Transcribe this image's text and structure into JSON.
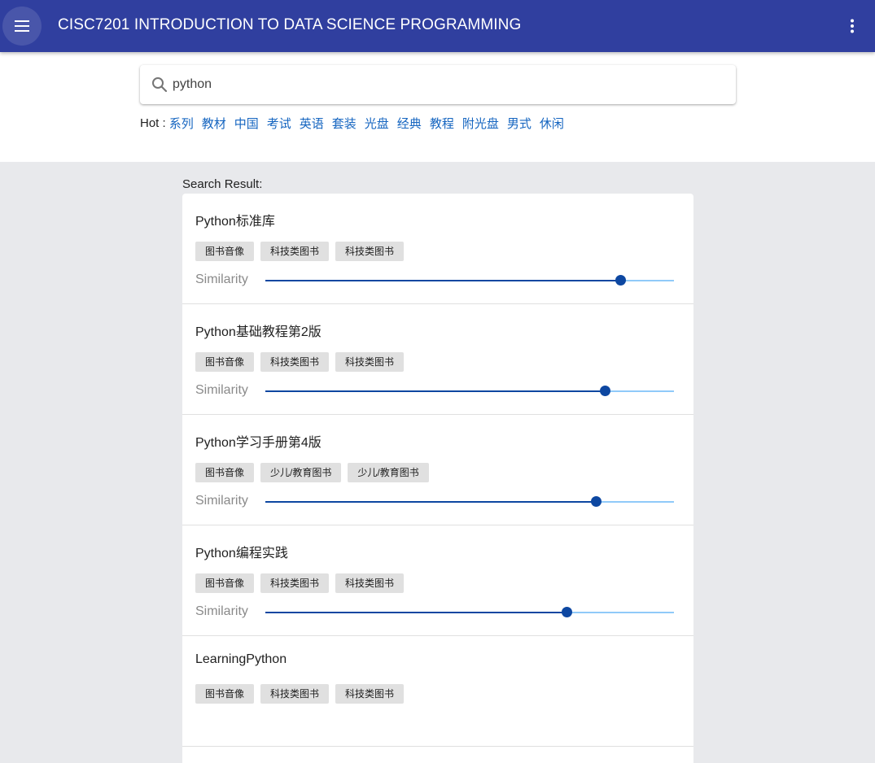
{
  "appbar": {
    "title": "CISC7201 INTRODUCTION TO DATA SCIENCE PROGRAMMING",
    "menu_icon": "hamburger-menu-icon",
    "more_icon": "more-vertical-icon",
    "color": "#303f9f"
  },
  "search": {
    "value": "python",
    "icon": "search-icon"
  },
  "hot": {
    "label": "Hot :",
    "links": [
      "系列",
      "教材",
      "中国",
      "考试",
      "英语",
      "套装",
      "光盘",
      "经典",
      "教程",
      "附光盘",
      "男式",
      "休闲"
    ]
  },
  "results_label": "Search Result:",
  "results": [
    {
      "title": "Python标准库",
      "tags": [
        "图书音像",
        "科技类图书",
        "科技类图书"
      ],
      "similarity_label": "Similarity",
      "similarity": 0.868
    },
    {
      "title": "Python基础教程第2版",
      "tags": [
        "图书音像",
        "科技类图书",
        "科技类图书"
      ],
      "similarity_label": "Similarity",
      "similarity": 0.831
    },
    {
      "title": "Python学习手册第4版",
      "tags": [
        "图书音像",
        "少儿/教育图书",
        "少儿/教育图书"
      ],
      "similarity_label": "Similarity",
      "similarity": 0.809
    },
    {
      "title": "Python编程实践",
      "tags": [
        "图书音像",
        "科技类图书",
        "科技类图书"
      ],
      "similarity_label": "Similarity",
      "similarity": 0.737
    },
    {
      "title": "LearningPython",
      "tags": [
        "图书音像",
        "科技类图书",
        "科技类图书"
      ],
      "similarity_label": "Similarity",
      "similarity": null
    }
  ],
  "colors": {
    "slider_active": "#0d47a1",
    "slider_track": "#90caf9",
    "link": "#1565c0"
  }
}
